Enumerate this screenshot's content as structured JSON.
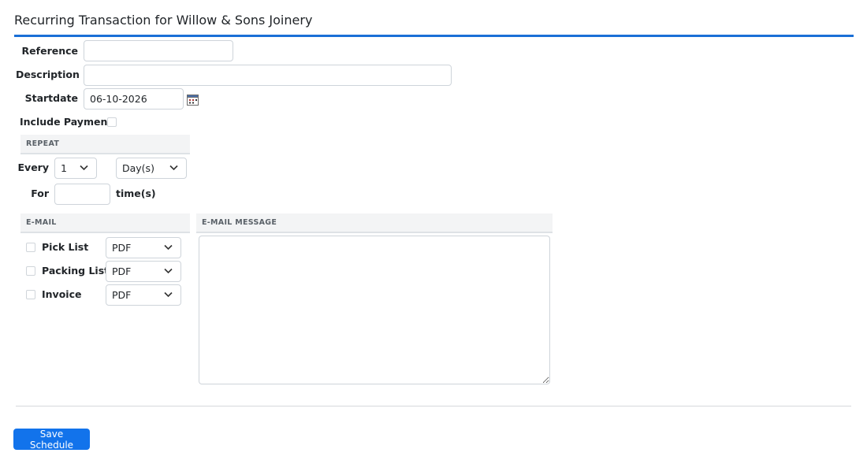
{
  "header": {
    "title": "Recurring Transaction for Willow & Sons Joinery"
  },
  "form": {
    "reference": {
      "label": "Reference",
      "value": ""
    },
    "description": {
      "label": "Description",
      "value": ""
    },
    "startdate": {
      "label": "Startdate",
      "value": "06-10-2026"
    },
    "include_payment": {
      "label": "Include Payment",
      "checked": false
    }
  },
  "repeat": {
    "heading": "REPEAT",
    "every_label": "Every",
    "every_value": "1",
    "unit_value": "Day(s)",
    "for_label": "For",
    "for_value": "",
    "times_label": "time(s)"
  },
  "email": {
    "heading": "E-MAIL",
    "items": [
      {
        "label": "Pick List",
        "format": "PDF",
        "checked": false
      },
      {
        "label": "Packing List",
        "format": "PDF",
        "checked": false
      },
      {
        "label": "Invoice",
        "format": "PDF",
        "checked": false
      }
    ]
  },
  "email_message": {
    "heading": "E-MAIL MESSAGE",
    "value": ""
  },
  "actions": {
    "save_label": "Save Schedule"
  },
  "colors": {
    "accent": "#1273eb",
    "title_rule": "#1a6fd6"
  },
  "icons": {
    "calendar": "calendar-icon",
    "chevron": "chevron-down-icon"
  }
}
